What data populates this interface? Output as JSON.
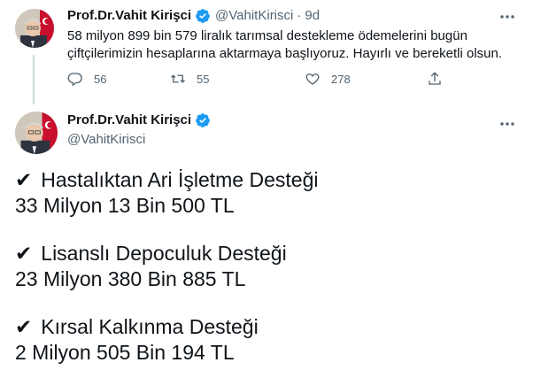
{
  "tweet1": {
    "name": "Prof.Dr.Vahit Kirişci",
    "handle": "@VahitKirisci",
    "dot": "·",
    "time": "9d",
    "text": "58 milyon 899 bin 579 liralık tarımsal destekleme ödemelerini bugün çiftçilerimizin hesaplarına aktarmaya başlıyoruz. Hayırlı ve bereketli olsun.",
    "replies": "56",
    "retweets": "55",
    "likes": "278"
  },
  "tweet2": {
    "name": "Prof.Dr.Vahit Kirişci",
    "handle": "@VahitKirisci",
    "check_glyph": "✔",
    "items": [
      {
        "title": "Hastalıktan Ari İşletme Desteği",
        "amount": "33 Milyon 13 Bin 500 TL"
      },
      {
        "title": "Lisanslı Depoculuk Desteği",
        "amount": "23 Milyon 380 Bin 885 TL"
      },
      {
        "title": "Kırsal Kalkınma Desteği",
        "amount": "2 Milyon 505 Bin 194 TL"
      }
    ]
  },
  "colors": {
    "text": "#0f1419",
    "secondary": "#536471",
    "verified": "#1d9bf0",
    "thread_line": "#cfd9de"
  },
  "icons": [
    "verified-badge-icon",
    "more-icon",
    "reply-icon",
    "retweet-icon",
    "like-icon",
    "share-icon",
    "checkmark-icon"
  ]
}
